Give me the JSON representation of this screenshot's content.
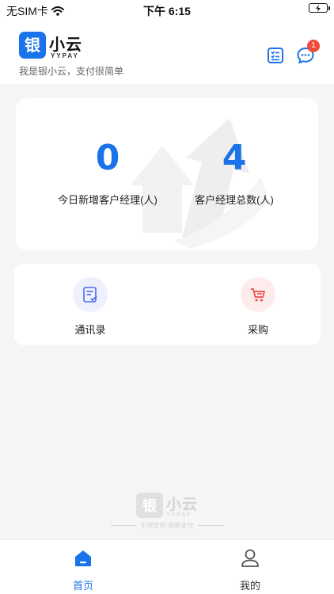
{
  "status_bar": {
    "carrier": "无SIM卡",
    "time": "下午 6:15"
  },
  "header": {
    "brand_name": "小云",
    "brand_sub": "YYPAY",
    "logo_char": "银",
    "slogan": "我是银小云，支付很简单",
    "notification_count": "1"
  },
  "stats": [
    {
      "value": "0",
      "label": "今日新增客户经理(人)"
    },
    {
      "value": "4",
      "label": "客户经理总数(人)"
    }
  ],
  "menu": [
    {
      "label": "通讯录",
      "icon": "contacts-icon"
    },
    {
      "label": "采购",
      "icon": "cart-icon"
    }
  ],
  "watermark": {
    "logo_char": "银",
    "name": "小云",
    "sub": "YYPAY",
    "tagline": "引领支付·创新支付"
  },
  "tabs": [
    {
      "label": "首页",
      "active": true
    },
    {
      "label": "我的",
      "active": false
    }
  ],
  "colors": {
    "accent": "#1a73e8",
    "badge": "#f04b3b",
    "contacts_bg": "#eef1fb",
    "cart_bg": "#fdeceb"
  }
}
